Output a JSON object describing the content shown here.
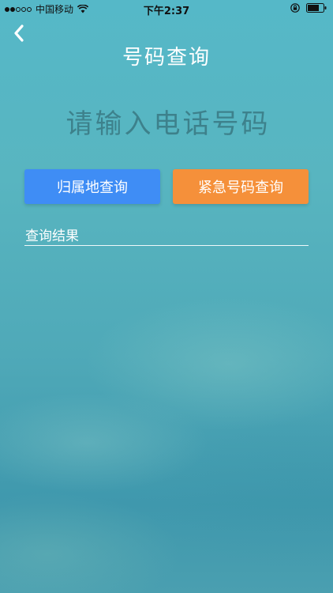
{
  "status_bar": {
    "carrier": "中国移动",
    "time": "下午2:37"
  },
  "header": {
    "title": "号码查询"
  },
  "search": {
    "placeholder": "请输入电话号码",
    "value": ""
  },
  "buttons": {
    "attribution_label": "归属地查询",
    "emergency_label": "紧急号码查询"
  },
  "result": {
    "label": "查询结果"
  },
  "colors": {
    "attribution_button": "#3f8df5",
    "emergency_button": "#f5903a",
    "title_text": "#ffffff"
  },
  "icons": {
    "back": "chevron-left-icon",
    "wifi": "wifi-icon",
    "lock": "rotation-lock-icon",
    "battery": "battery-icon"
  }
}
